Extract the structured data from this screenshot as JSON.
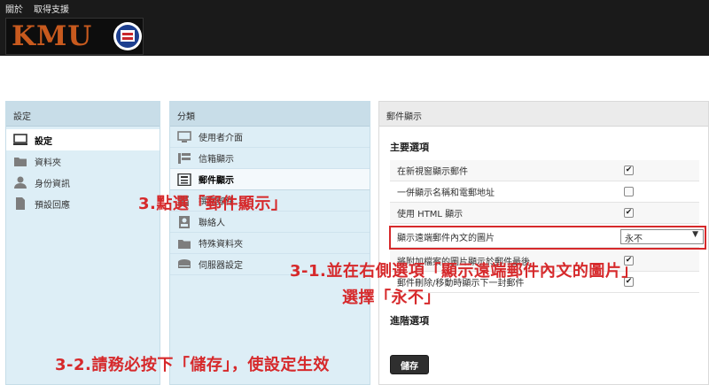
{
  "topmenu": {
    "about": "關於",
    "help": "取得支援"
  },
  "logo": {
    "text": "KMU"
  },
  "left_panel": {
    "title": "設定",
    "items": [
      {
        "label": "設定",
        "icon": "monitor-icon",
        "active": true
      },
      {
        "label": "資料夾",
        "icon": "folder-icon"
      },
      {
        "label": "身份資訊",
        "icon": "person-icon"
      },
      {
        "label": "預設回應",
        "icon": "document-icon"
      }
    ]
  },
  "mid_panel": {
    "title": "分類",
    "items": [
      {
        "label": "使用者介面",
        "icon": "monitor-icon"
      },
      {
        "label": "信箱顯示",
        "icon": "list-icon"
      },
      {
        "label": "郵件顯示",
        "icon": "mail-view-icon",
        "active": true
      },
      {
        "label": "撰寫郵件",
        "icon": "compose-icon"
      },
      {
        "label": "聯絡人",
        "icon": "contacts-icon"
      },
      {
        "label": "特殊資料夾",
        "icon": "folder-icon"
      },
      {
        "label": "伺服器設定",
        "icon": "server-icon"
      }
    ]
  },
  "right_panel": {
    "title": "郵件顯示",
    "main_section": "主要選項",
    "advanced_section": "進階選項",
    "options": [
      {
        "label": "在新視窗顯示郵件",
        "checked": true
      },
      {
        "label": "一併顯示名稱和電郵地址",
        "checked": false
      },
      {
        "label": "使用 HTML 顯示",
        "checked": true
      },
      {
        "label": "顯示遠端郵件內文的圖片",
        "type": "select",
        "value": "永不"
      },
      {
        "label": "將附加檔案的圖片顯示於郵件最後",
        "checked": true
      },
      {
        "label": "郵件刪除/移動時顯示下一封郵件",
        "checked": true
      }
    ],
    "save_label": "儲存"
  },
  "annotations": {
    "step3": "3.點選「郵件顯示」",
    "step31_line1": "3-1.並在右側選項「顯示遠端郵件內文的圖片」",
    "step31_line2": "選擇「永不」",
    "step32": "3-2.請務必按下「儲存」，使設定生效"
  },
  "colors": {
    "accent_red": "#d6292b",
    "header_bg": "#1a1a1a",
    "panel_bg": "#ddeef6"
  }
}
